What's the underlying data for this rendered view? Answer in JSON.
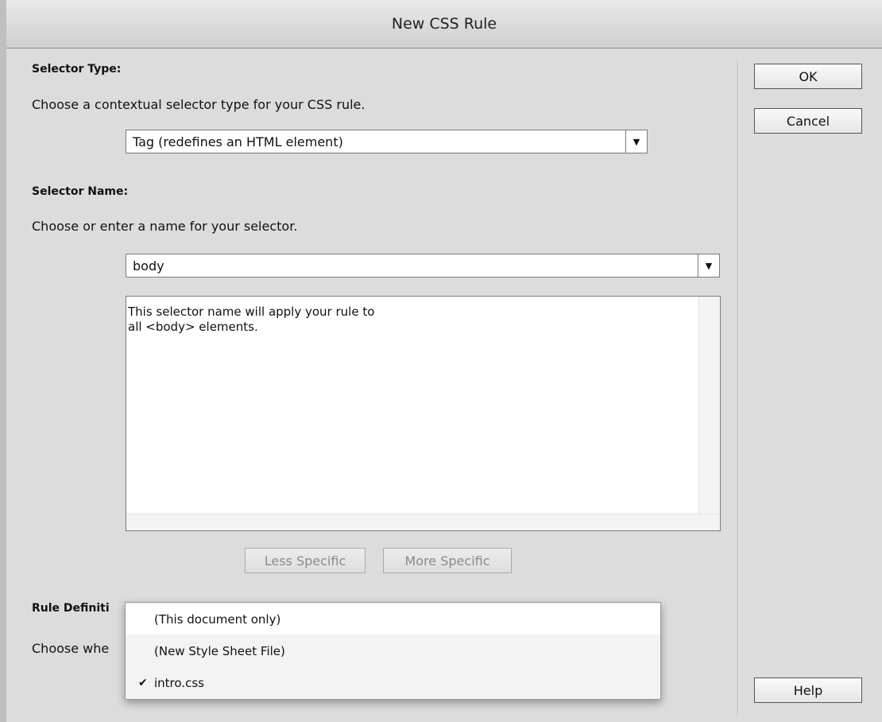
{
  "window": {
    "title": "New CSS Rule"
  },
  "selector_type": {
    "heading": "Selector Type:",
    "instruction": "Choose a contextual selector type for your CSS rule.",
    "selected_value": "Tag (redefines an HTML element)"
  },
  "selector_name": {
    "heading": "Selector Name:",
    "instruction": "Choose or enter a name for your selector.",
    "value": "body",
    "description_line1": "This selector name will apply your rule to",
    "description_line2": "all <body> elements.",
    "less_specific_label": "Less Specific",
    "more_specific_label": "More Specific"
  },
  "rule_definition": {
    "heading_visible": "Rule Definiti",
    "instruction_visible": "Choose whe",
    "options": [
      {
        "label": "(This document only)",
        "checked": false,
        "highlighted": true
      },
      {
        "label": "(New Style Sheet File)",
        "checked": false,
        "highlighted": false
      },
      {
        "label": "intro.css",
        "checked": true,
        "highlighted": false
      }
    ],
    "check_glyph": "✔"
  },
  "buttons": {
    "ok_label": "OK",
    "cancel_label": "Cancel",
    "help_label": "Help"
  },
  "icons": {
    "dropdown_arrow": "chevron-down-icon",
    "dropdown_arrow_glyph": "▼"
  }
}
